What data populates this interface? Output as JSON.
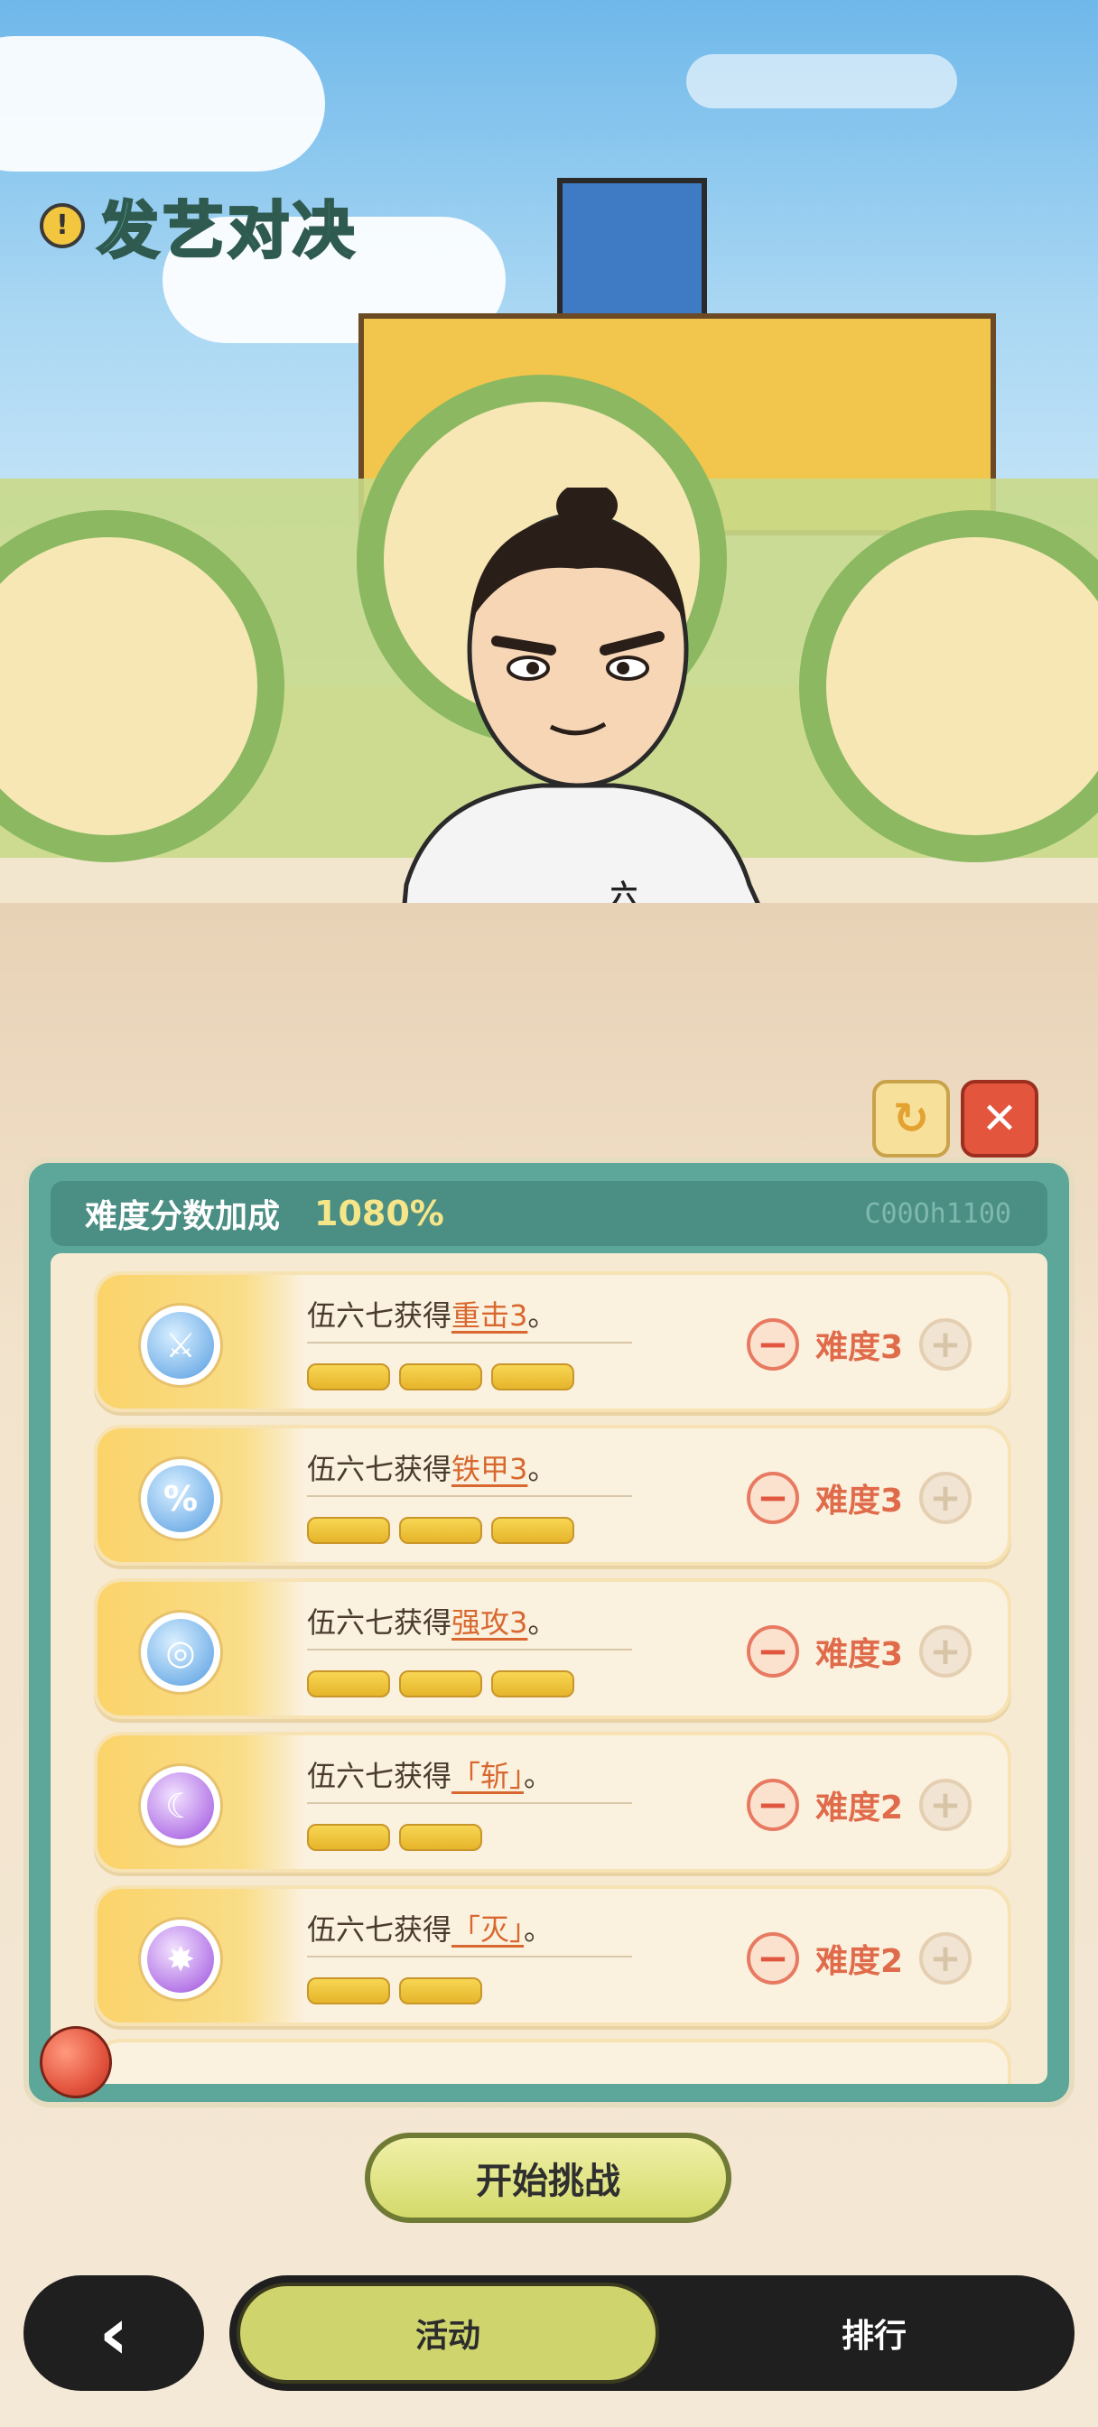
{
  "header": {
    "title": "发艺对决",
    "info_icon": "!"
  },
  "scene": {
    "shirt_text": "六七"
  },
  "panel": {
    "bonus_label": "难度分数加成",
    "bonus_value": "1080%",
    "code": "C00Oh1100"
  },
  "items": [
    {
      "prefix": "伍六七获得",
      "skill": "重击3",
      "suffix": "。",
      "difficulty": "难度3",
      "level": 3,
      "icon": "sword-icon",
      "icon_glyph": "⚔"
    },
    {
      "prefix": "伍六七获得",
      "skill": "铁甲3",
      "suffix": "。",
      "difficulty": "难度3",
      "level": 3,
      "icon": "armor-icon",
      "icon_glyph": "%"
    },
    {
      "prefix": "伍六七获得",
      "skill": "强攻3",
      "suffix": "。",
      "difficulty": "难度3",
      "level": 3,
      "icon": "strike-icon",
      "icon_glyph": "◎"
    },
    {
      "prefix": "伍六七获得",
      "skill": "「斩」",
      "suffix": "。",
      "difficulty": "难度2",
      "level": 2,
      "icon": "slash-icon",
      "icon_glyph": "☾"
    },
    {
      "prefix": "伍六七获得",
      "skill": "「灭」",
      "suffix": "。",
      "difficulty": "难度2",
      "level": 2,
      "icon": "destroy-icon",
      "icon_glyph": "✸"
    }
  ],
  "controls": {
    "minus": "−",
    "plus": "+"
  },
  "actions": {
    "start_label": "开始挑战",
    "refresh_icon": "↻",
    "close_icon": "✕"
  },
  "nav": {
    "back_icon": "‹",
    "tab_activity": "活动",
    "tab_ranking": "排行"
  },
  "colors": {
    "panel": "#5da69a",
    "accent": "#d8682f",
    "bonus": "#f6e68a"
  }
}
